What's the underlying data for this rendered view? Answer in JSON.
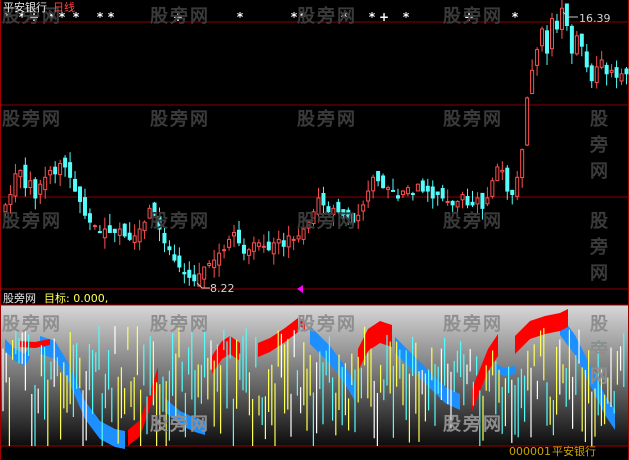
{
  "top_panel": {
    "stock_name": "平安银行",
    "period_label": "日线",
    "high_label": "16.39",
    "low_label": "8.22"
  },
  "bottom_panel": {
    "indicator_name": "股旁网",
    "target_label": "目标: 0.000,",
    "footer_code": "000001",
    "footer_name": "平安银行"
  },
  "watermark": "股旁网",
  "colors": {
    "up_candle": "#ff5050",
    "down_candle": "#54fcfc",
    "grid": "#8b0000",
    "red_band": "#ff0000",
    "blue_band": "#1e8fff",
    "yellow_bar": "#ffff54",
    "cyan_bar": "#54fcfc",
    "white_bar": "#ffffff",
    "marker": "#ffffff",
    "arrow": "#ff00ff"
  },
  "chart_data": {
    "type": "candlestick",
    "price_high": 16.39,
    "price_low": 8.22,
    "target_value": 0.0,
    "closes": [
      10.6,
      10.9,
      11.5,
      11.6,
      11.1,
      11.3,
      10.8,
      11.2,
      11.4,
      11.6,
      11.5,
      11.8,
      11.7,
      11.4,
      11.0,
      10.7,
      10.3,
      10.1,
      10.0,
      9.8,
      9.9,
      9.8,
      9.8,
      9.9,
      9.7,
      9.6,
      9.7,
      9.9,
      10.1,
      10.5,
      10.3,
      9.9,
      9.5,
      9.3,
      9.0,
      8.8,
      8.6,
      8.5,
      8.4,
      8.6,
      8.8,
      8.9,
      9.0,
      9.2,
      9.3,
      9.6,
      9.8,
      9.5,
      9.2,
      9.3,
      9.5,
      9.5,
      9.4,
      9.3,
      9.5,
      9.6,
      9.4,
      9.7,
      9.6,
      9.7,
      9.9,
      10.1,
      10.4,
      10.8,
      10.6,
      10.4,
      10.5,
      10.4,
      10.3,
      10.2,
      10.1,
      10.3,
      10.6,
      11.0,
      11.4,
      11.3,
      11.1,
      11.1,
      11.0,
      10.8,
      11.0,
      11.1,
      10.9,
      11.2,
      11.0,
      11.0,
      10.8,
      10.9,
      10.8,
      10.7,
      10.6,
      10.7,
      10.9,
      10.6,
      10.6,
      10.8,
      10.5,
      10.8,
      11.3,
      11.7,
      11.6,
      11.0,
      10.9,
      11.4,
      12.2,
      13.7,
      14.5,
      15.1,
      15.7,
      15.0,
      16.0,
      15.7,
      16.3,
      15.8,
      15.0,
      15.5,
      15.2,
      14.6,
      14.2,
      14.6,
      14.8,
      14.4,
      14.5,
      14.3,
      14.4,
      14.4
    ]
  }
}
